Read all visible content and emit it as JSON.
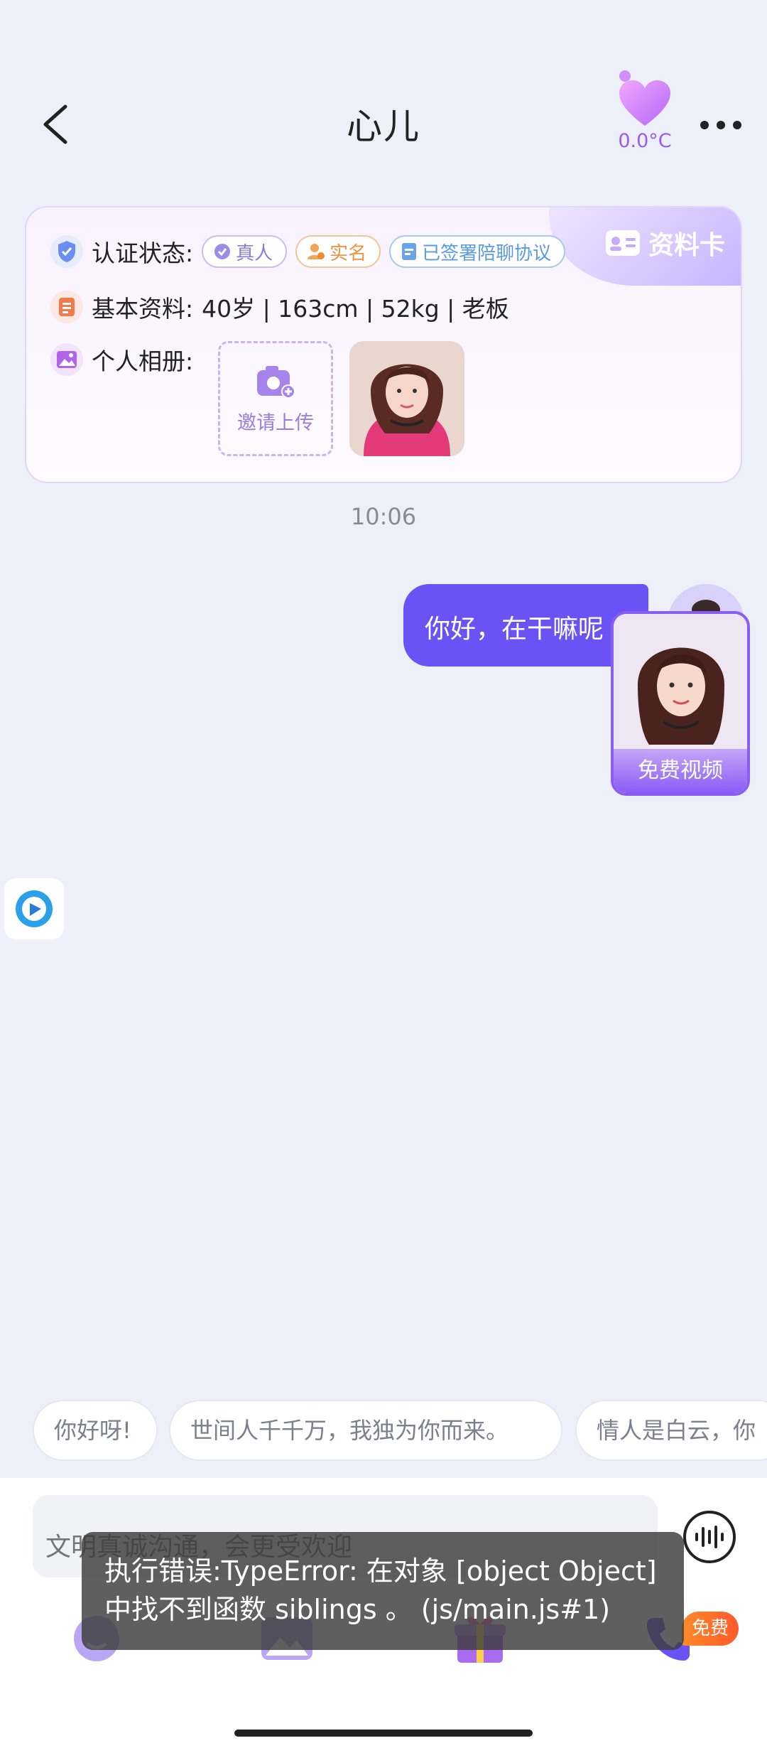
{
  "header": {
    "title": "心儿",
    "heart_temp": "0.0°C"
  },
  "profile_card": {
    "tag_label": "资料卡",
    "verify_label": "认证状态:",
    "badges": {
      "real": "真人",
      "name": "实名",
      "agreement": "已签署陪聊协议"
    },
    "basic_label": "基本资料:",
    "basic_info": "40岁 | 163cm | 52kg | 老板",
    "album_label": "个人相册:",
    "upload_text": "邀请上传"
  },
  "chat": {
    "time": "10:06",
    "message": "你好，在干嘛呢",
    "video_label": "免费视频"
  },
  "quick_replies": [
    "你好呀!",
    "世间人千千万，我独为你而来。",
    "情人是白云，你"
  ],
  "input": {
    "placeholder": "文明真诚沟通，会更受欢迎"
  },
  "toolbar": {
    "free_badge": "免费"
  },
  "toast": {
    "line1": "执行错误:TypeError: 在对象 [object Object]",
    "line2": "中找不到函数 siblings 。 (js/main.js#1)"
  },
  "colors": {
    "accent": "#6b52f5",
    "purple": "#9a5cf0",
    "background": "#eef0f9"
  }
}
